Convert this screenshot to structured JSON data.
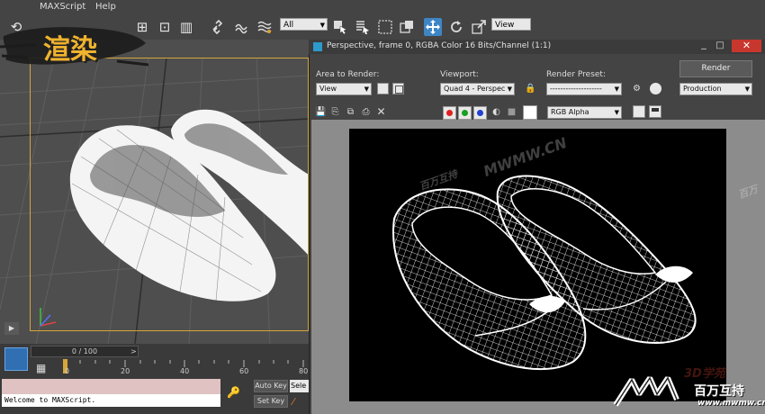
{
  "menubar": {
    "items": [
      "MAXScript",
      "Help"
    ]
  },
  "toolbar": {
    "selection_filter": "All",
    "ref_coord": "View"
  },
  "overlay": {
    "title": "渲染"
  },
  "viewport": {},
  "timeline": {
    "frame_readout": "0 / 100",
    "prev_label": "<",
    "next_label": ">",
    "ruler_ticks": [
      "0",
      "20",
      "40",
      "60",
      "80"
    ]
  },
  "status": {
    "listener_text": "Welcome to MAXScript.",
    "auto_key": "Auto Key",
    "set_key": "Set Key",
    "selected": "Sele"
  },
  "render_window": {
    "title": "Perspective, frame 0, RGBA Color 16 Bits/Channel (1:1)",
    "area_label": "Area to Render:",
    "area_value": "View",
    "viewport_label": "Viewport:",
    "viewport_value": "Quad 4 - Perspec",
    "preset_label": "Render Preset:",
    "preset_value": "--------------------",
    "render_button": "Render",
    "production_value": "Production",
    "channel_value": "RGB Alpha"
  },
  "watermarks": {
    "site": "MWMW.CN",
    "brand": "百万互持",
    "brand_url": "www.mwmw.cn",
    "mid_brand": "百万互持",
    "edge": "百万",
    "school": "3D学苑"
  },
  "colors": {
    "accent": "#f0b32e",
    "viewport_border": "#d6a63a"
  }
}
